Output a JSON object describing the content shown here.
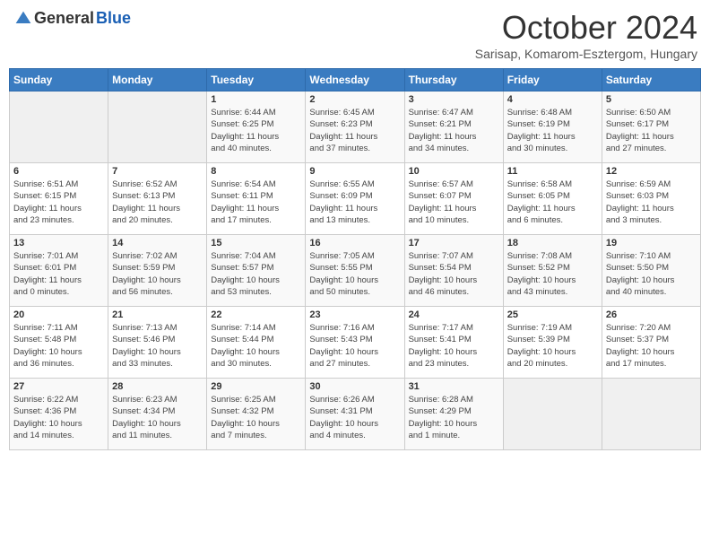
{
  "header": {
    "logo_general": "General",
    "logo_blue": "Blue",
    "month": "October 2024",
    "location": "Sarisap, Komarom-Esztergom, Hungary"
  },
  "days_of_week": [
    "Sunday",
    "Monday",
    "Tuesday",
    "Wednesday",
    "Thursday",
    "Friday",
    "Saturday"
  ],
  "weeks": [
    [
      {
        "day": "",
        "info": ""
      },
      {
        "day": "",
        "info": ""
      },
      {
        "day": "1",
        "info": "Sunrise: 6:44 AM\nSunset: 6:25 PM\nDaylight: 11 hours\nand 40 minutes."
      },
      {
        "day": "2",
        "info": "Sunrise: 6:45 AM\nSunset: 6:23 PM\nDaylight: 11 hours\nand 37 minutes."
      },
      {
        "day": "3",
        "info": "Sunrise: 6:47 AM\nSunset: 6:21 PM\nDaylight: 11 hours\nand 34 minutes."
      },
      {
        "day": "4",
        "info": "Sunrise: 6:48 AM\nSunset: 6:19 PM\nDaylight: 11 hours\nand 30 minutes."
      },
      {
        "day": "5",
        "info": "Sunrise: 6:50 AM\nSunset: 6:17 PM\nDaylight: 11 hours\nand 27 minutes."
      }
    ],
    [
      {
        "day": "6",
        "info": "Sunrise: 6:51 AM\nSunset: 6:15 PM\nDaylight: 11 hours\nand 23 minutes."
      },
      {
        "day": "7",
        "info": "Sunrise: 6:52 AM\nSunset: 6:13 PM\nDaylight: 11 hours\nand 20 minutes."
      },
      {
        "day": "8",
        "info": "Sunrise: 6:54 AM\nSunset: 6:11 PM\nDaylight: 11 hours\nand 17 minutes."
      },
      {
        "day": "9",
        "info": "Sunrise: 6:55 AM\nSunset: 6:09 PM\nDaylight: 11 hours\nand 13 minutes."
      },
      {
        "day": "10",
        "info": "Sunrise: 6:57 AM\nSunset: 6:07 PM\nDaylight: 11 hours\nand 10 minutes."
      },
      {
        "day": "11",
        "info": "Sunrise: 6:58 AM\nSunset: 6:05 PM\nDaylight: 11 hours\nand 6 minutes."
      },
      {
        "day": "12",
        "info": "Sunrise: 6:59 AM\nSunset: 6:03 PM\nDaylight: 11 hours\nand 3 minutes."
      }
    ],
    [
      {
        "day": "13",
        "info": "Sunrise: 7:01 AM\nSunset: 6:01 PM\nDaylight: 11 hours\nand 0 minutes."
      },
      {
        "day": "14",
        "info": "Sunrise: 7:02 AM\nSunset: 5:59 PM\nDaylight: 10 hours\nand 56 minutes."
      },
      {
        "day": "15",
        "info": "Sunrise: 7:04 AM\nSunset: 5:57 PM\nDaylight: 10 hours\nand 53 minutes."
      },
      {
        "day": "16",
        "info": "Sunrise: 7:05 AM\nSunset: 5:55 PM\nDaylight: 10 hours\nand 50 minutes."
      },
      {
        "day": "17",
        "info": "Sunrise: 7:07 AM\nSunset: 5:54 PM\nDaylight: 10 hours\nand 46 minutes."
      },
      {
        "day": "18",
        "info": "Sunrise: 7:08 AM\nSunset: 5:52 PM\nDaylight: 10 hours\nand 43 minutes."
      },
      {
        "day": "19",
        "info": "Sunrise: 7:10 AM\nSunset: 5:50 PM\nDaylight: 10 hours\nand 40 minutes."
      }
    ],
    [
      {
        "day": "20",
        "info": "Sunrise: 7:11 AM\nSunset: 5:48 PM\nDaylight: 10 hours\nand 36 minutes."
      },
      {
        "day": "21",
        "info": "Sunrise: 7:13 AM\nSunset: 5:46 PM\nDaylight: 10 hours\nand 33 minutes."
      },
      {
        "day": "22",
        "info": "Sunrise: 7:14 AM\nSunset: 5:44 PM\nDaylight: 10 hours\nand 30 minutes."
      },
      {
        "day": "23",
        "info": "Sunrise: 7:16 AM\nSunset: 5:43 PM\nDaylight: 10 hours\nand 27 minutes."
      },
      {
        "day": "24",
        "info": "Sunrise: 7:17 AM\nSunset: 5:41 PM\nDaylight: 10 hours\nand 23 minutes."
      },
      {
        "day": "25",
        "info": "Sunrise: 7:19 AM\nSunset: 5:39 PM\nDaylight: 10 hours\nand 20 minutes."
      },
      {
        "day": "26",
        "info": "Sunrise: 7:20 AM\nSunset: 5:37 PM\nDaylight: 10 hours\nand 17 minutes."
      }
    ],
    [
      {
        "day": "27",
        "info": "Sunrise: 6:22 AM\nSunset: 4:36 PM\nDaylight: 10 hours\nand 14 minutes."
      },
      {
        "day": "28",
        "info": "Sunrise: 6:23 AM\nSunset: 4:34 PM\nDaylight: 10 hours\nand 11 minutes."
      },
      {
        "day": "29",
        "info": "Sunrise: 6:25 AM\nSunset: 4:32 PM\nDaylight: 10 hours\nand 7 minutes."
      },
      {
        "day": "30",
        "info": "Sunrise: 6:26 AM\nSunset: 4:31 PM\nDaylight: 10 hours\nand 4 minutes."
      },
      {
        "day": "31",
        "info": "Sunrise: 6:28 AM\nSunset: 4:29 PM\nDaylight: 10 hours\nand 1 minute."
      },
      {
        "day": "",
        "info": ""
      },
      {
        "day": "",
        "info": ""
      }
    ]
  ]
}
